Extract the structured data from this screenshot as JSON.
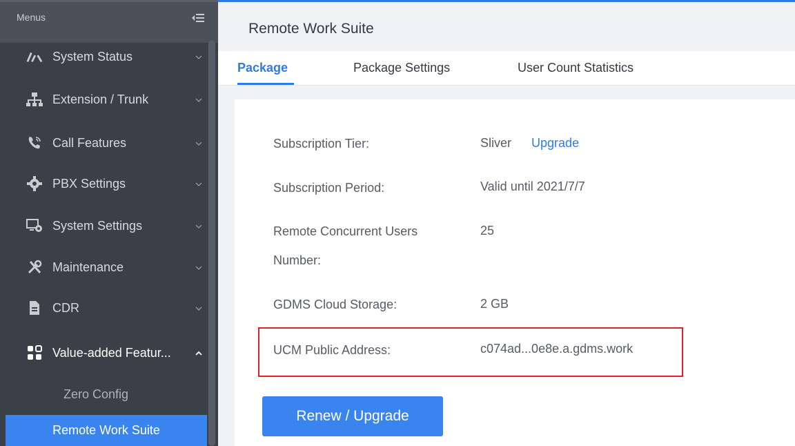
{
  "sidebar": {
    "header_label": "Menus",
    "items": [
      {
        "label": "System Status",
        "icon": "gauge-icon"
      },
      {
        "label": "Extension / Trunk",
        "icon": "network-icon"
      },
      {
        "label": "Call Features",
        "icon": "phone-icon"
      },
      {
        "label": "PBX Settings",
        "icon": "gear-icon"
      },
      {
        "label": "System Settings",
        "icon": "system-settings-icon"
      },
      {
        "label": "Maintenance",
        "icon": "tools-icon"
      },
      {
        "label": "CDR",
        "icon": "document-icon"
      },
      {
        "label": "Value-added Featur...",
        "icon": "grid-icon"
      }
    ],
    "sub_items": [
      {
        "label": "Zero Config"
      },
      {
        "label": "Remote Work Suite"
      }
    ]
  },
  "main": {
    "title": "Remote Work Suite",
    "tabs": [
      {
        "label": "Package",
        "active": true
      },
      {
        "label": "Package Settings",
        "active": false
      },
      {
        "label": "User Count Statistics",
        "active": false
      }
    ],
    "rows": [
      {
        "label": "Subscription Tier:",
        "value": "Sliver",
        "link": "Upgrade"
      },
      {
        "label": "Subscription Period:",
        "value": "Valid until 2021/7/7"
      },
      {
        "label": "Remote Concurrent Users",
        "label_line2": "Number:",
        "value": "25"
      },
      {
        "label": "GDMS Cloud Storage:",
        "value": "2 GB"
      },
      {
        "label": "UCM Public Address:",
        "value": "c074ad...0e8e.a.gdms.work"
      }
    ],
    "button_label": "Renew / Upgrade"
  },
  "colors": {
    "accent": "#2e7be6",
    "sidebar_bg": "#3a4048",
    "highlight_border": "#e3202a"
  }
}
